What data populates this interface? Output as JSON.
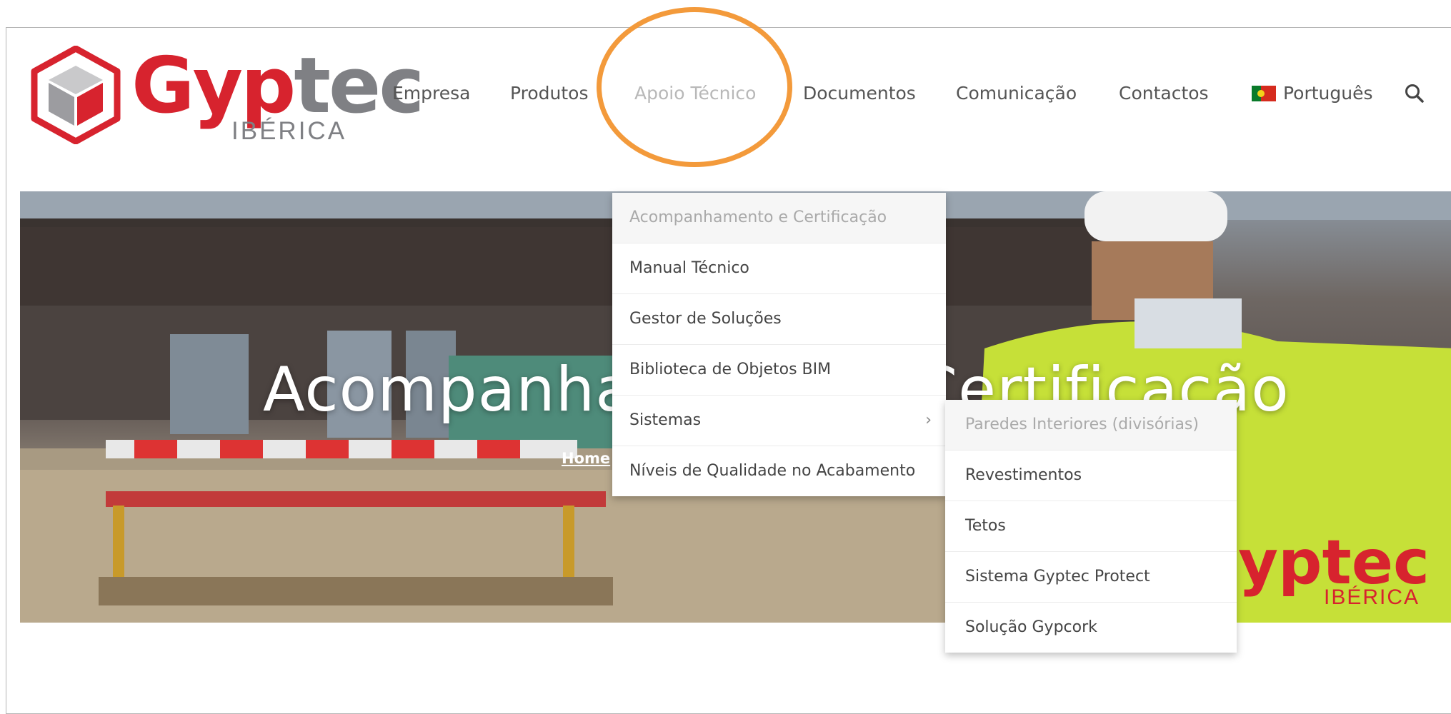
{
  "logo": {
    "brand_part1": "Gyp",
    "brand_part2": "tec",
    "sub": "IBÉRICA",
    "colors": {
      "red": "#d7232e",
      "gray": "#7f8084"
    }
  },
  "nav": {
    "items": [
      "Empresa",
      "Produtos",
      "Apoio Técnico",
      "Documentos",
      "Comunicação",
      "Contactos"
    ],
    "active": "Apoio Técnico",
    "language": "Português",
    "search_icon": "search-icon"
  },
  "hero": {
    "title": "Acompanhamento e Certificação",
    "breadcrumb": "Home",
    "vest_brand": "yptec",
    "vest_sub": "IBÉRICA"
  },
  "dropdown": {
    "items": [
      "Acompanhamento e Certificação",
      "Manual Técnico",
      "Gestor de Soluções",
      "Biblioteca de Objetos BIM",
      "Sistemas",
      "Níveis de Qualidade no Acabamento"
    ],
    "submenu_parent": "Sistemas"
  },
  "submenu": {
    "items": [
      "Paredes Interiores (divisórias)",
      "Revestimentos",
      "Tetos",
      "Sistema Gyptec Protect",
      "Solução Gypcork"
    ]
  },
  "highlight_color": "#f39a3b"
}
